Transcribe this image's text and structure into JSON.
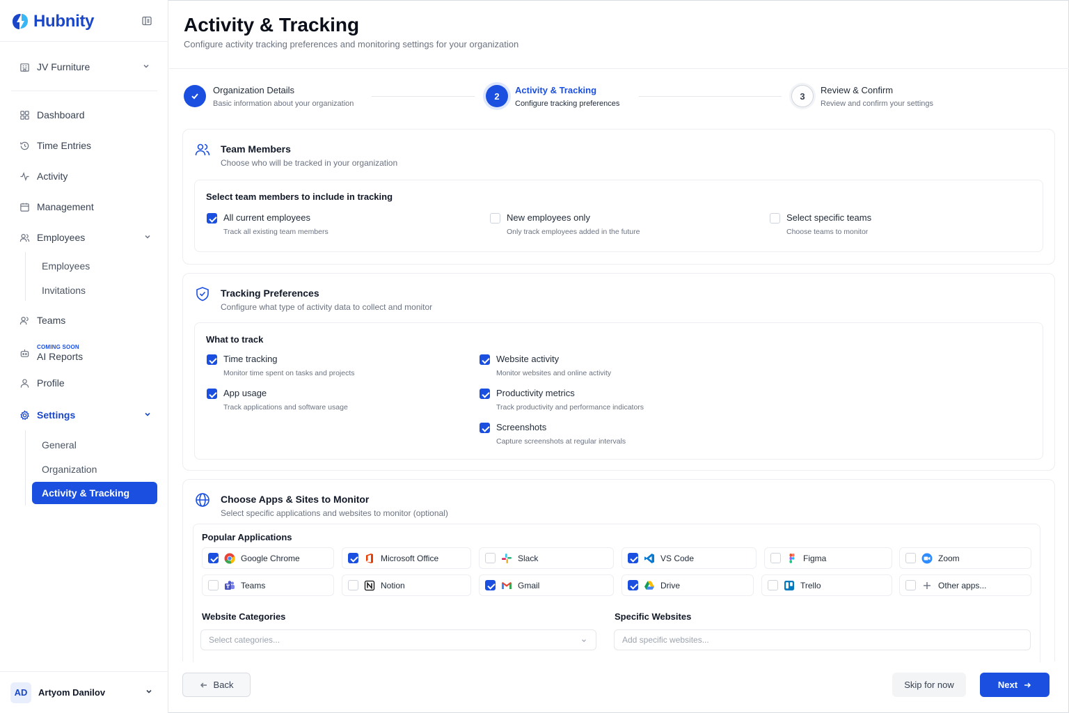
{
  "brand": {
    "name": "Hubnity"
  },
  "sidebar": {
    "org": "JV Furniture",
    "items": {
      "dashboard": "Dashboard",
      "time_entries": "Time Entries",
      "activity": "Activity",
      "management": "Management",
      "employees": "Employees",
      "employees_sub": [
        "Employees",
        "Invitations"
      ],
      "teams": "Teams",
      "ai_badge": "COMING SOON",
      "ai_reports": "AI Reports",
      "profile": "Profile",
      "settings": "Settings",
      "settings_sub": [
        "General",
        "Organization",
        "Activity & Tracking"
      ]
    },
    "user": {
      "initials": "AD",
      "name": "Artyom Danilov"
    }
  },
  "header": {
    "title": "Activity & Tracking",
    "subtitle": "Configure activity tracking preferences and monitoring settings for your organization"
  },
  "steps": [
    {
      "number": "1",
      "title": "Organization Details",
      "desc": "Basic information about your organization",
      "state": "done"
    },
    {
      "number": "2",
      "title": "Activity & Tracking",
      "desc": "Configure tracking preferences",
      "state": "active"
    },
    {
      "number": "3",
      "title": "Review & Confirm",
      "desc": "Review and confirm your settings",
      "state": "todo"
    }
  ],
  "team_members": {
    "title": "Team Members",
    "subtitle": "Choose who will be tracked in your organization",
    "inner_title": "Select team members to include in tracking",
    "options": [
      {
        "label": "All current employees",
        "desc": "Track all existing team members",
        "checked": true
      },
      {
        "label": "New employees only",
        "desc": "Only track employees added in the future",
        "checked": false
      },
      {
        "label": "Select specific teams",
        "desc": "Choose teams to monitor",
        "checked": false
      }
    ]
  },
  "tracking": {
    "title": "Tracking Preferences",
    "subtitle": "Configure what type of activity data to collect and monitor",
    "inner_title": "What to track",
    "options": [
      {
        "label": "Time tracking",
        "desc": "Monitor time spent on tasks and projects",
        "checked": true
      },
      {
        "label": "App usage",
        "desc": "Track applications and software usage",
        "checked": true
      },
      {
        "label": "Website activity",
        "desc": "Monitor websites and online activity",
        "checked": true
      },
      {
        "label": "Productivity metrics",
        "desc": "Track productivity and performance indicators",
        "checked": true
      },
      {
        "label": "Screenshots",
        "desc": "Capture screenshots at regular intervals",
        "checked": true
      }
    ]
  },
  "apps": {
    "title": "Choose Apps & Sites to Monitor",
    "subtitle": "Select specific applications and websites to monitor (optional)",
    "popular_title": "Popular Applications",
    "items": [
      {
        "name": "Google Chrome",
        "icon": "chrome-icon",
        "checked": true
      },
      {
        "name": "Microsoft Office",
        "icon": "office-icon",
        "checked": true
      },
      {
        "name": "Slack",
        "icon": "slack-icon",
        "checked": false
      },
      {
        "name": "VS Code",
        "icon": "vscode-icon",
        "checked": true
      },
      {
        "name": "Figma",
        "icon": "figma-icon",
        "checked": false
      },
      {
        "name": "Zoom",
        "icon": "zoom-icon",
        "checked": false
      },
      {
        "name": "Teams",
        "icon": "teams-icon",
        "checked": false
      },
      {
        "name": "Notion",
        "icon": "notion-icon",
        "checked": false
      },
      {
        "name": "Gmail",
        "icon": "gmail-icon",
        "checked": true
      },
      {
        "name": "Drive",
        "icon": "drive-icon",
        "checked": true
      },
      {
        "name": "Trello",
        "icon": "trello-icon",
        "checked": false
      },
      {
        "name": "Other apps...",
        "icon": "plus-icon",
        "checked": false
      }
    ],
    "website_categories_label": "Website Categories",
    "website_categories_placeholder": "Select categories...",
    "specific_websites_label": "Specific Websites",
    "specific_websites_placeholder": "Add specific websites..."
  },
  "footer": {
    "back": "Back",
    "skip": "Skip for now",
    "next": "Next"
  },
  "colors": {
    "accent": "#1a4fe0",
    "brand": "#1a47c9"
  }
}
